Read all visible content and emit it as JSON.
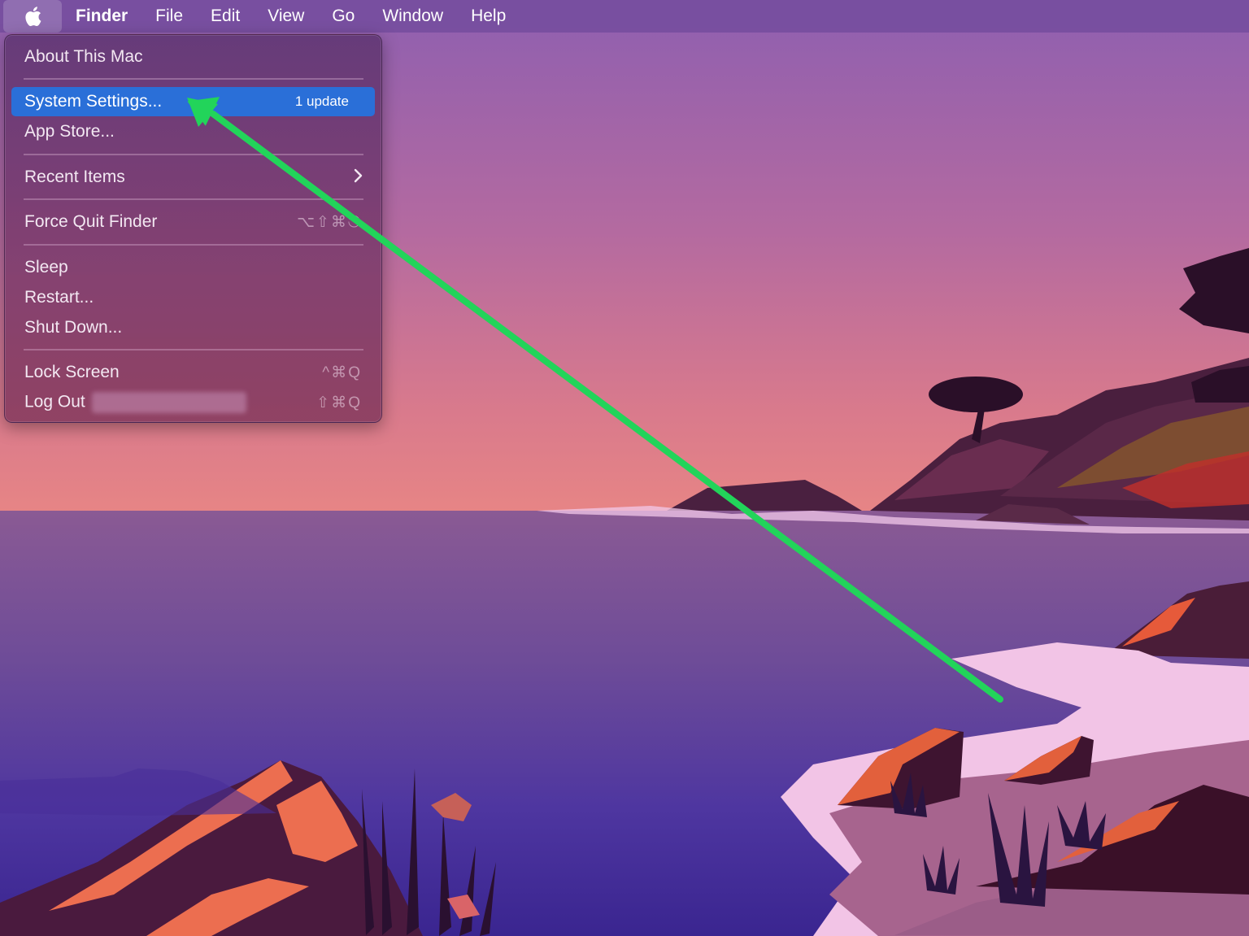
{
  "menubar": {
    "apple_icon": "apple-logo",
    "app_name": "Finder",
    "items": [
      "File",
      "Edit",
      "View",
      "Go",
      "Window",
      "Help"
    ]
  },
  "apple_menu": {
    "items": [
      {
        "label": "About This Mac",
        "shortcut": ""
      },
      {
        "label": "System Settings...",
        "badge": "1 update",
        "highlighted": true
      },
      {
        "label": "App Store...",
        "shortcut": ""
      },
      {
        "label": "Recent Items",
        "submenu_icon": "chevron-right"
      },
      {
        "label": "Force Quit Finder",
        "shortcut": "⌥⇧⌘⎋"
      },
      {
        "label": "Sleep",
        "shortcut": ""
      },
      {
        "label": "Restart...",
        "shortcut": ""
      },
      {
        "label": "Shut Down...",
        "shortcut": ""
      },
      {
        "label": "Lock Screen",
        "shortcut": "^⌘Q"
      },
      {
        "label": "Log Out",
        "username_redacted": true,
        "shortcut": "⇧⌘Q"
      }
    ]
  },
  "annotation": {
    "type": "arrow",
    "color": "#22d45a",
    "points_to": "System Settings..."
  },
  "colors": {
    "highlight": "#2a6fd8",
    "arrow": "#22d45a"
  }
}
